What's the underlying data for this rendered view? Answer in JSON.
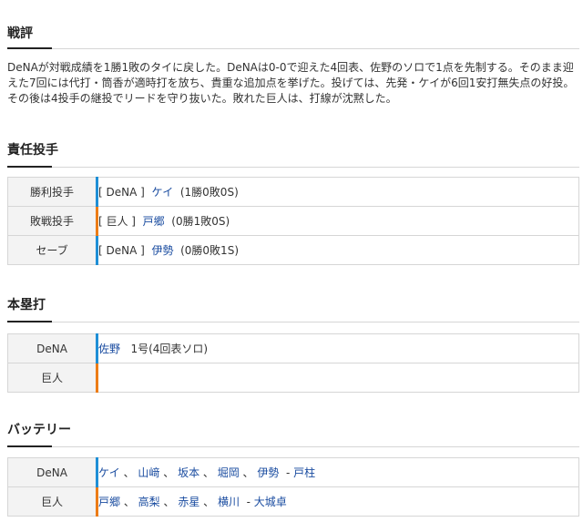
{
  "review": {
    "title": "戦評",
    "text": "DeNAが対戦成績を1勝1敗のタイに戻した。DeNAは0-0で迎えた4回表、佐野のソロで1点を先制する。そのまま迎えた7回には代打・筒香が適時打を放ち、貴重な追加点を挙げた。投げては、先発・ケイが6回1安打無失点の好投。その後は4投手の継投でリードを守り抜いた。敗れた巨人は、打線が沈黙した。"
  },
  "pitchers": {
    "title": "責任投手",
    "rows": [
      {
        "label": "勝利投手",
        "team": "[ DeNA ]",
        "name": "ケイ",
        "record": "(1勝0敗0S)"
      },
      {
        "label": "敗戦投手",
        "team": "[ 巨人 ]",
        "name": "戸郷",
        "record": "(0勝1敗0S)"
      },
      {
        "label": "セーブ",
        "team": "[ DeNA ]",
        "name": "伊勢",
        "record": "(0勝0敗1S)"
      }
    ]
  },
  "homeruns": {
    "title": "本塁打",
    "rows": [
      {
        "team": "DeNA",
        "player": "佐野",
        "detail": "1号(4回表ソロ)"
      },
      {
        "team": "巨人",
        "player": "",
        "detail": ""
      }
    ]
  },
  "battery": {
    "title": "バッテリー",
    "rows": [
      {
        "team": "DeNA",
        "pitchers": [
          "ケイ",
          "山﨑",
          "坂本",
          "堀岡",
          "伊勢"
        ],
        "catcher": "戸柱"
      },
      {
        "team": "巨人",
        "pitchers": [
          "戸郷",
          "高梨",
          "赤星",
          "横川"
        ],
        "catcher": "大城卓"
      }
    ]
  },
  "colors": {
    "dena": "#1e8fd6",
    "giants": "#ec7c16",
    "link": "#1a4ca0"
  }
}
